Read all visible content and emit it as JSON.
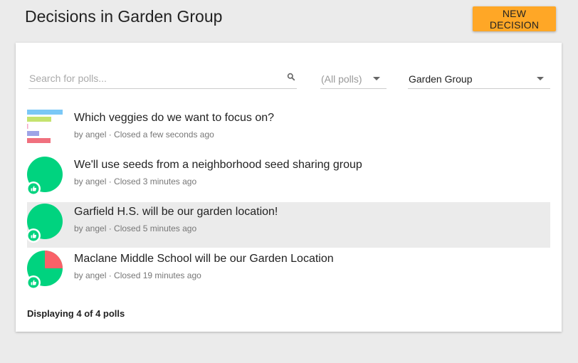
{
  "header": {
    "title": "Decisions in Garden Group",
    "new_decision_label": "NEW DECISION"
  },
  "filters": {
    "search_placeholder": "Search for polls...",
    "status_filter": "(All polls)",
    "group_filter": "Garden Group"
  },
  "polls": [
    {
      "title": "Which veggies do we want to focus on?",
      "author": "by angel",
      "status": "Closed a few seconds ago",
      "thumbnail": "bar-chart",
      "bar_fractions": [
        1.0,
        0.68,
        0.02,
        0.34,
        0.66
      ],
      "bar_colors": [
        "#7bc8f6",
        "#c5e36e",
        "#f4a7c7",
        "#9ea3e6",
        "#f0707e"
      ]
    },
    {
      "title": "We'll use seeds from a neighborhood seed sharing group",
      "author": "by angel",
      "status": "Closed 3 minutes ago",
      "thumbnail": "pie",
      "agree_fraction": 1.0,
      "outcome_icon": "thumbs-up-icon"
    },
    {
      "title": "Garfield H.S. will be our garden location!",
      "author": "by angel",
      "status": "Closed 5 minutes ago",
      "thumbnail": "pie",
      "agree_fraction": 1.0,
      "outcome_icon": "thumbs-up-icon",
      "highlighted": true
    },
    {
      "title": "Maclane Middle School will be our Garden Location",
      "author": "by angel",
      "status": "Closed 19 minutes ago",
      "thumbnail": "pie",
      "agree_fraction": 0.75,
      "disagree_fraction": 0.25,
      "outcome_icon": "thumbs-up-icon"
    }
  ],
  "footer": {
    "count_text": "Displaying 4 of 4 polls"
  },
  "colors": {
    "accent": "#ffa726",
    "agree": "#00d37f",
    "disagree": "#f96168",
    "highlight_row": "#ebebeb"
  }
}
